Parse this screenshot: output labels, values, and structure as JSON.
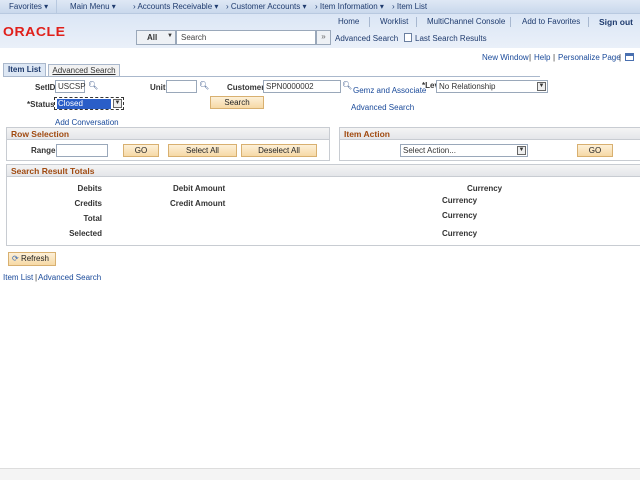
{
  "nav": {
    "items": [
      "Favorites ▾",
      "Main Menu ▾",
      "›  Accounts Receivable ▾",
      "›  Customer Accounts ▾",
      "›  Item Information ▾",
      "›  Item List"
    ]
  },
  "header": {
    "logo": "ORACLE",
    "links": [
      "Home",
      "Worklist",
      "MultiChannel Console",
      "Add to Favorites",
      "Sign out"
    ],
    "search_scope": "All",
    "search_placeholder": "Search",
    "advanced_search": "Advanced Search",
    "last_results": "Last Search Results"
  },
  "pagelinks": {
    "new_window": "New Window",
    "help": "Help",
    "personalize": "Personalize Page"
  },
  "tabs": [
    "Item List",
    "Advanced Search"
  ],
  "form": {
    "setid_label": "SetID",
    "setid": "USCSP",
    "unit_label": "Unit",
    "unit": "",
    "customer_label": "Customer",
    "customer": "SPN0000002",
    "customer_name": "Gemz and Associate",
    "level_label": "*Lev",
    "level": "No Relationship",
    "status_label": "*Status",
    "status": "Closed",
    "search_button": "Search",
    "advanced_search": "Advanced Search",
    "add_conversation": "Add Conversation"
  },
  "row_selection": {
    "title": "Row Selection",
    "range_label": "Range",
    "range": "",
    "go": "GO",
    "select_all": "Select All",
    "deselect_all": "Deselect All"
  },
  "item_action": {
    "title": "Item Action",
    "select": "Select Action...",
    "go": "GO"
  },
  "totals": {
    "title": "Search Result Totals",
    "debits": "Debits",
    "debit_amount": "Debit Amount",
    "credits": "Credits",
    "credit_amount": "Credit Amount",
    "total": "Total",
    "selected": "Selected",
    "currency": "Currency"
  },
  "refresh": "Refresh",
  "footer": {
    "item_list": "Item List",
    "sep": "|",
    "advanced_search": "Advanced Search"
  }
}
